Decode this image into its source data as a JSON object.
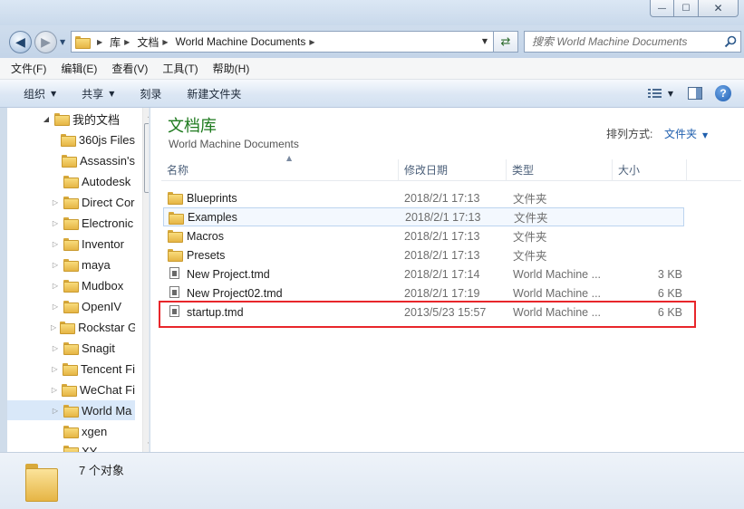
{
  "window": {
    "minimize_glyph": "—",
    "maximize_glyph": "☐",
    "close_glyph": "✕"
  },
  "address": {
    "crumbs": [
      "库",
      "文档",
      "World Machine Documents"
    ],
    "search_placeholder": "搜索 World Machine Documents"
  },
  "menu": [
    "文件(F)",
    "编辑(E)",
    "查看(V)",
    "工具(T)",
    "帮助(H)"
  ],
  "toolbar": {
    "organize": "组织",
    "share": "共享",
    "burn": "刻录",
    "new_folder": "新建文件夹",
    "help": "?"
  },
  "tree": {
    "items": [
      {
        "label": "我的文档"
      },
      {
        "label": "360js Files"
      },
      {
        "label": "Assassin's"
      },
      {
        "label": "Autodesk"
      },
      {
        "label": "Direct Cor"
      },
      {
        "label": "Electronic"
      },
      {
        "label": "Inventor"
      },
      {
        "label": "maya"
      },
      {
        "label": "Mudbox"
      },
      {
        "label": "OpenIV"
      },
      {
        "label": "Rockstar G"
      },
      {
        "label": "Snagit"
      },
      {
        "label": "Tencent Fi"
      },
      {
        "label": "WeChat Fi"
      },
      {
        "label": "World Ma"
      },
      {
        "label": "xgen"
      },
      {
        "label": "XY"
      }
    ]
  },
  "library": {
    "title": "文档库",
    "subtitle": "World Machine Documents",
    "arrange_label": "排列方式:",
    "arrange_value": "文件夹"
  },
  "columns": {
    "name": "名称",
    "date": "修改日期",
    "type": "类型",
    "size": "大小"
  },
  "files": [
    {
      "name": "Blueprints",
      "date": "2018/2/1 17:13",
      "type": "文件夹",
      "size": "",
      "icon": "folder-icon"
    },
    {
      "name": "Examples",
      "date": "2018/2/1 17:13",
      "type": "文件夹",
      "size": "",
      "icon": "folder-icon"
    },
    {
      "name": "Macros",
      "date": "2018/2/1 17:13",
      "type": "文件夹",
      "size": "",
      "icon": "folder-icon"
    },
    {
      "name": "Presets",
      "date": "2018/2/1 17:13",
      "type": "文件夹",
      "size": "",
      "icon": "folder-icon"
    },
    {
      "name": "New Project.tmd",
      "date": "2018/2/1 17:14",
      "type": "World Machine ...",
      "size": "3 KB",
      "icon": "file-icon"
    },
    {
      "name": "New Project02.tmd",
      "date": "2018/2/1 17:19",
      "type": "World Machine ...",
      "size": "6 KB",
      "icon": "file-icon"
    },
    {
      "name": "startup.tmd",
      "date": "2013/5/23 15:57",
      "type": "World Machine ...",
      "size": "6 KB",
      "icon": "file-icon"
    }
  ],
  "status": {
    "count": "7 个对象"
  },
  "colors": {
    "highlight": "#e8262b",
    "library_title": "#1e7a1e",
    "link": "#1f5fae"
  }
}
